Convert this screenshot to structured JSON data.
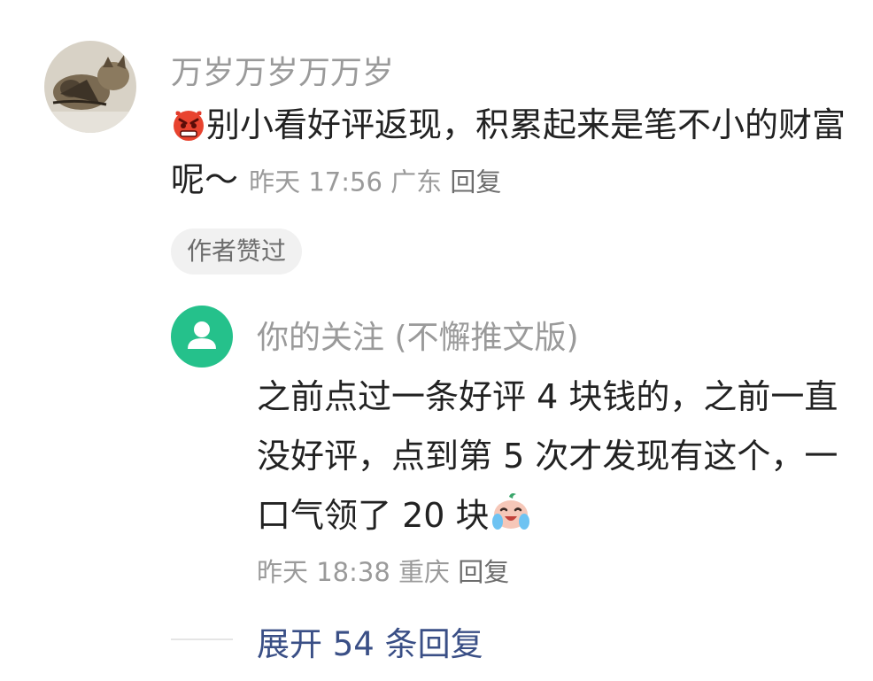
{
  "comment": {
    "username": "万岁万岁万万岁",
    "text": "别小看好评返现，积累起来是笔不小的财富呢～",
    "time": "昨天 17:56",
    "location": "广东",
    "reply_label": "回复",
    "author_liked_chip": "作者赞过"
  },
  "reply": {
    "username": "你的关注 (不懈推文版)",
    "text": "之前点过一条好评 4 块钱的，之前一直没好评，点到第 5 次才发现有这个，一口气领了 20 块",
    "time": "昨天 18:38",
    "location": "重庆",
    "reply_label": "回复"
  },
  "expand": {
    "label": "展开 54 条回复"
  },
  "icons": {
    "comment_avatar": "cat-photo-avatar",
    "comment_emoji": "angry-face-emoji",
    "reply_avatar": "default-user-icon",
    "reply_emoji": "crying-laughing-emoji"
  },
  "colors": {
    "accent_link": "#3a4f86",
    "avatar_green": "#25c18b",
    "muted_text": "#9a9a9a",
    "body_text": "#222222"
  }
}
